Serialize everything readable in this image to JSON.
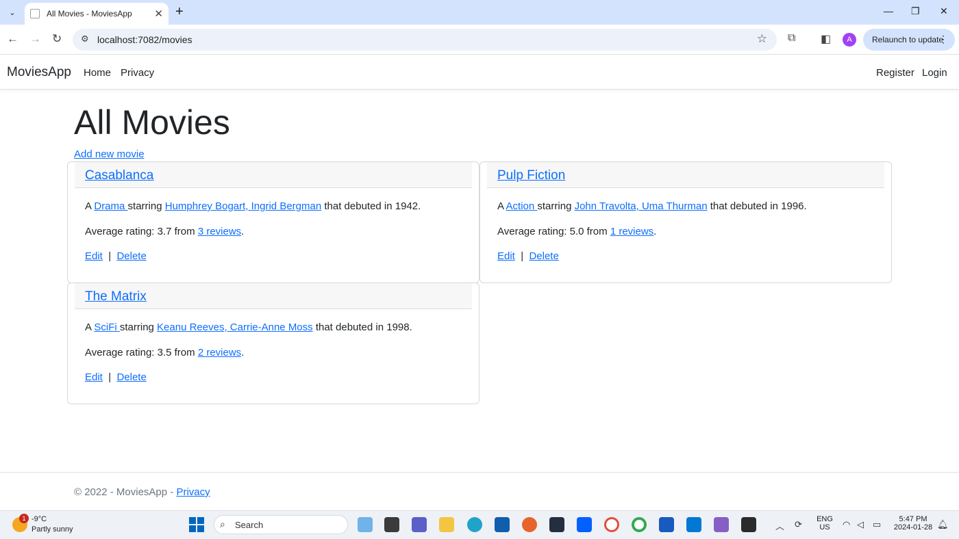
{
  "browser": {
    "tab_title": "All Movies - MoviesApp",
    "tab_close": "✕",
    "new_tab": "+",
    "url": "localhost:7082/movies",
    "relaunch_label": "Relaunch to update",
    "avatar_letter": "A"
  },
  "app": {
    "brand": "MoviesApp",
    "nav": {
      "home": "Home",
      "privacy": "Privacy",
      "register": "Register",
      "login": "Login"
    }
  },
  "page": {
    "title": "All Movies",
    "add_new": "Add new movie"
  },
  "movies": [
    {
      "title": "Casablanca",
      "prefix": "A ",
      "genre": "Drama ",
      "starring": "starring ",
      "actors": "Humphrey Bogart, Ingrid Bergman",
      "debut": " that debuted in 1942.",
      "rating_text": "Average rating: 3.7 from ",
      "reviews": "3 reviews",
      "edit": "Edit",
      "sep": "|",
      "delete": "Delete"
    },
    {
      "title": "Pulp Fiction",
      "prefix": "A ",
      "genre": "Action ",
      "starring": "starring ",
      "actors": "John Travolta, Uma Thurman",
      "debut": " that debuted in 1996.",
      "rating_text": "Average rating: 5.0 from ",
      "reviews": "1 reviews",
      "edit": "Edit",
      "sep": "|",
      "delete": "Delete"
    },
    {
      "title": "The Matrix",
      "prefix": "A ",
      "genre": "SciFi ",
      "starring": "starring ",
      "actors": "Keanu Reeves, Carrie-Anne Moss",
      "debut": " that debuted in 1998.",
      "rating_text": "Average rating: 3.5 from ",
      "reviews": "2 reviews",
      "edit": "Edit",
      "sep": "|",
      "delete": "Delete"
    }
  ],
  "footer": {
    "copyright": "© 2022 - MoviesApp - ",
    "privacy": "Privacy"
  },
  "taskbar": {
    "weather_temp": "-9°C",
    "weather_desc": "Partly sunny",
    "weather_badge": "1",
    "search_label": "Search",
    "lang_1": "ENG",
    "lang_2": "US",
    "time": "5:47 PM",
    "date": "2024-01-28"
  }
}
